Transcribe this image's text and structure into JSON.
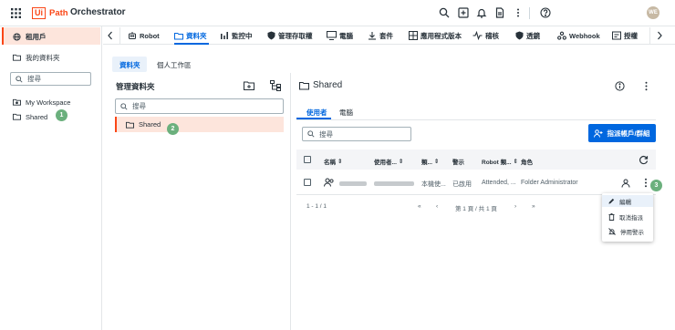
{
  "header": {
    "logo_box": "Ui",
    "logo_path": "Path",
    "product": "Orchestrator",
    "avatar": "WE",
    "icons": [
      "search-icon",
      "add-icon",
      "bell-icon",
      "document-icon",
      "more-vert-icon",
      "help-icon"
    ]
  },
  "sidebar": {
    "tenant": "租用戶",
    "my_folders": "我的資料夾",
    "search_placeholder": "搜尋",
    "items": [
      {
        "label": "My Workspace",
        "icon": "workspace-folder-icon"
      },
      {
        "label": "Shared",
        "icon": "folder-icon",
        "badge": "1"
      }
    ]
  },
  "tabs": [
    {
      "label": "Robot",
      "icon": "robot-icon"
    },
    {
      "label": "資料夾",
      "icon": "folder-icon",
      "active": true
    },
    {
      "label": "監控中",
      "icon": "chart-icon"
    },
    {
      "label": "管理存取權",
      "icon": "shield-icon"
    },
    {
      "label": "電腦",
      "icon": "monitor-icon"
    },
    {
      "label": "套件",
      "icon": "download-icon"
    },
    {
      "label": "應用程式版本",
      "icon": "apps-icon"
    },
    {
      "label": "稽核",
      "icon": "pulse-icon"
    },
    {
      "label": "透鏡",
      "icon": "shield-icon"
    },
    {
      "label": "Webhook",
      "icon": "webhook-icon"
    },
    {
      "label": "授權",
      "icon": "license-icon"
    }
  ],
  "subtabs": [
    {
      "label": "資料夾",
      "active": true
    },
    {
      "label": "個人工作區",
      "active": false
    }
  ],
  "folder_pane": {
    "title": "管理資料夾",
    "search_placeholder": "搜尋",
    "tree": [
      {
        "label": "Shared",
        "badge": "2"
      }
    ]
  },
  "detail_pane": {
    "title": "Shared",
    "tabs": [
      {
        "label": "使用者",
        "active": true
      },
      {
        "label": "電腦",
        "active": false
      }
    ],
    "search_placeholder": "搜尋",
    "assign_button": "指派帳戶/群組",
    "columns": [
      "名稱",
      "使用者...",
      "類...",
      "警示",
      "Robot 類...",
      "角色"
    ],
    "rows": [
      {
        "name": "",
        "user": "",
        "type": "本機使...",
        "alerts": "已啟用",
        "robot_type": "Attended, ...",
        "role": "Folder Administrator",
        "badge": "3"
      }
    ],
    "pager": {
      "range": "1 - 1 / 1",
      "page": "第 1 頁 / 共 1 頁"
    }
  },
  "context_menu": {
    "items": [
      {
        "label": "編輯",
        "icon": "pencil-icon",
        "highlighted": true
      },
      {
        "label": "取消指派",
        "icon": "trash-icon"
      },
      {
        "label": "停用警示",
        "icon": "alert-off-icon"
      }
    ]
  },
  "colors": {
    "brand": "#fa4616",
    "accent": "#0067df",
    "badge": "#6bb07d",
    "selected_bg": "#fde5dc"
  }
}
